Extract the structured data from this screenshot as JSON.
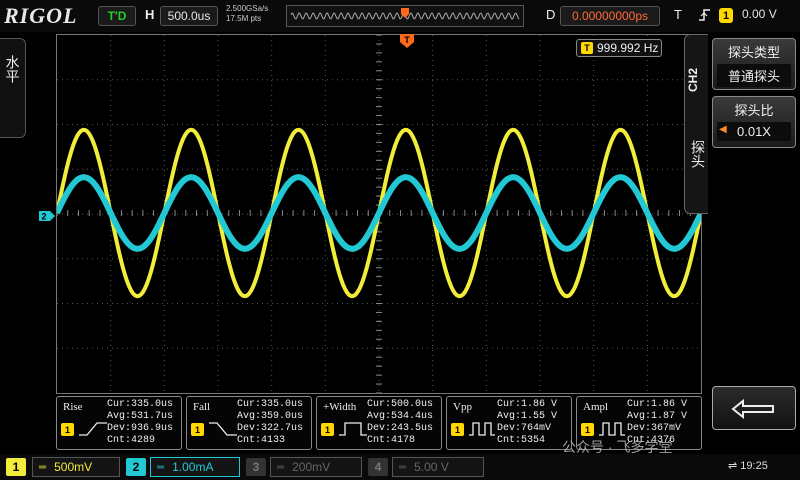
{
  "header": {
    "logo": "RIGOL",
    "run_state": "T'D",
    "h_label": "H",
    "timebase": "500.0us",
    "sample_rate": "2.500GSa/s",
    "memory_depth": "17.5M pts",
    "d_label": "D",
    "delay": "0.00000000ps",
    "t_label": "T",
    "trigger_edge_icon": "rising-edge-icon",
    "trigger_source": "1",
    "trigger_level": "0.00 V"
  },
  "left_tab": {
    "label": "水平"
  },
  "display": {
    "frequency": "999.992 Hz",
    "trigger_marker": "T",
    "ch2_marker": "2",
    "colors": {
      "ch1": "#f2ec3a",
      "ch2": "#22c9d4",
      "grid": "#555555",
      "trigger": "#ff6a1a"
    },
    "ch1_amplitude_div": 1.86,
    "ch2_amplitude_div": 0.8
  },
  "right_menu": {
    "channel_tab": "CH2",
    "side_label": "探头",
    "probe_type_title": "探头类型",
    "probe_type_value": "普通探头",
    "probe_ratio_title": "探头比",
    "probe_ratio_value": "0.01X",
    "back_icon": "return-arrow-icon"
  },
  "measurements": [
    {
      "name": "Rise",
      "channel": "1",
      "cur": "Cur:335.0us",
      "avg": "Avg:531.7us",
      "dev": "Dev:936.9us",
      "cnt": "Cnt:4289"
    },
    {
      "name": "Fall",
      "channel": "1",
      "cur": "Cur:335.0us",
      "avg": "Avg:359.0us",
      "dev": "Dev:322.7us",
      "cnt": "Cnt:4133"
    },
    {
      "name": "+Width",
      "channel": "1",
      "cur": "Cur:500.0us",
      "avg": "Avg:534.4us",
      "dev": "Dev:243.5us",
      "cnt": "Cnt:4178"
    },
    {
      "name": "Vpp",
      "channel": "1",
      "cur": "Cur:1.86 V",
      "avg": "Avg:1.55 V",
      "dev": "Dev:764mV",
      "cnt": "Cnt:5354"
    },
    {
      "name": "Ampl",
      "channel": "1",
      "cur": "Cur:1.86 V",
      "avg": "Avg:1.87 V",
      "dev": "Dev:367mV",
      "cnt": "Cnt:4376"
    }
  ],
  "footer": {
    "ch1_num": "1",
    "ch1_scale": "500mV",
    "ch2_num": "2",
    "ch2_scale": "1.00mA",
    "ch3_num": "3",
    "ch3_scale": "200mV",
    "ch4_num": "4",
    "ch4_scale": "5.00 V",
    "time": "19:25",
    "usb_icon": "usb-icon",
    "watermark": "公众号 · 飞多学堂"
  }
}
